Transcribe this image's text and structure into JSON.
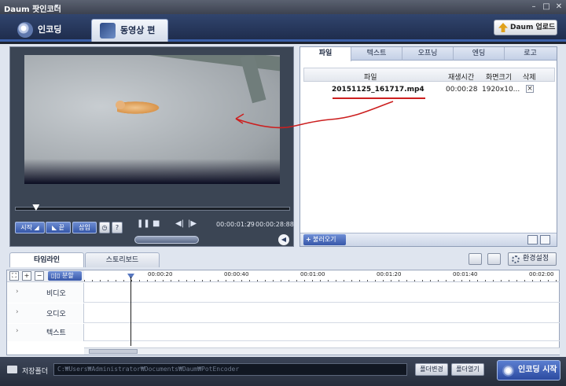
{
  "window": {
    "title": "Daum 팟인코더"
  },
  "main_tabs": {
    "encoding": "인코딩",
    "edit": "동영상 편집"
  },
  "upgrade_label": "Daum 업로드",
  "player": {
    "time_current": "00:00:01:29",
    "time_total": "00:00:28:88",
    "seek_progress": 0.063,
    "buttons": {
      "start": "시작",
      "end": "끝",
      "insert": "삽입",
      "help": "?"
    }
  },
  "file_panel": {
    "tabs": [
      "파일",
      "텍스트",
      "오프닝",
      "엔딩",
      "로고"
    ],
    "columns": [
      "파일",
      "재생시간",
      "화면크기",
      "삭제"
    ],
    "rows": [
      {
        "name": "20151125_161717.mp4",
        "duration": "00:00:28",
        "size": "1920x10...",
        "delete": "×"
      }
    ],
    "add_label": "불러오기"
  },
  "timeline_tabs": [
    "타임라인",
    "스토리보드"
  ],
  "env_settings": "환경설정",
  "timeline": {
    "split_label": "분할",
    "ruler": [
      "00:00:20",
      "00:00:40",
      "00:01:00",
      "00:01:20",
      "00:01:40",
      "00:02:00"
    ],
    "tracks": [
      "비디오",
      "오디오",
      "텍스트"
    ]
  },
  "bottom": {
    "save_label": "저장폴더",
    "save_path": "C:₩Users₩Administrator₩Documents₩Daum₩PotEncoder",
    "change_folder": "폴더변경",
    "open_folder": "폴더열기",
    "start_encoding": "인코딩 시작"
  },
  "colors": {
    "accent_blue": "#3557a8",
    "annotation_red": "#cc1f1f"
  }
}
